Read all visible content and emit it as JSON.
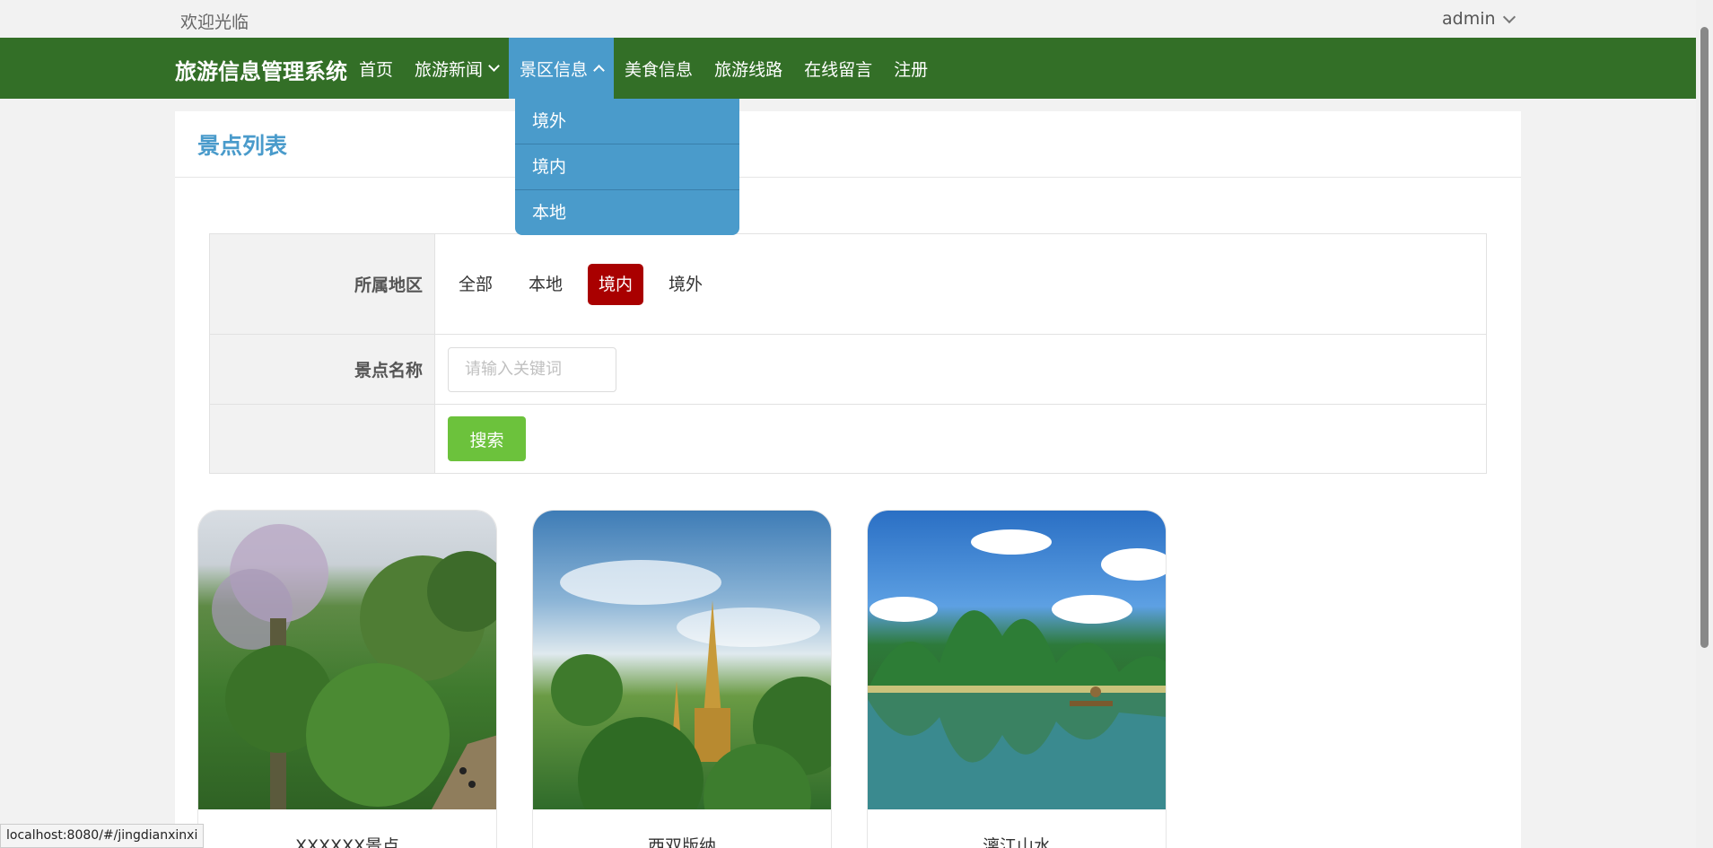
{
  "topbar": {
    "welcome": "欢迎光临",
    "user": "admin"
  },
  "navbar": {
    "brand": "旅游信息管理系统",
    "items": [
      {
        "label": "首页"
      },
      {
        "label": "旅游新闻"
      },
      {
        "label": "景区信息"
      },
      {
        "label": "美食信息"
      },
      {
        "label": "旅游线路"
      },
      {
        "label": "在线留言"
      },
      {
        "label": "注册"
      }
    ],
    "dropdown": [
      "境外",
      "境内",
      "本地"
    ]
  },
  "page": {
    "title": "景点列表",
    "filter": {
      "region_label": "所属地区",
      "region_options": [
        "全部",
        "本地",
        "境内",
        "境外"
      ],
      "region_selected": "境内",
      "name_label": "景点名称",
      "name_placeholder": "请输入关键词",
      "search_button": "搜索"
    },
    "spots": [
      {
        "name": "XXXXXX景点"
      },
      {
        "name": "西双版纳"
      },
      {
        "name": "漓江山水"
      }
    ]
  },
  "status_url": "localhost:8080/#/jingdianxinxi",
  "colors": {
    "nav_green": "#336f27",
    "accent_blue": "#4a9bcb",
    "active_red": "#a90000",
    "button_green": "#6cc23c"
  }
}
